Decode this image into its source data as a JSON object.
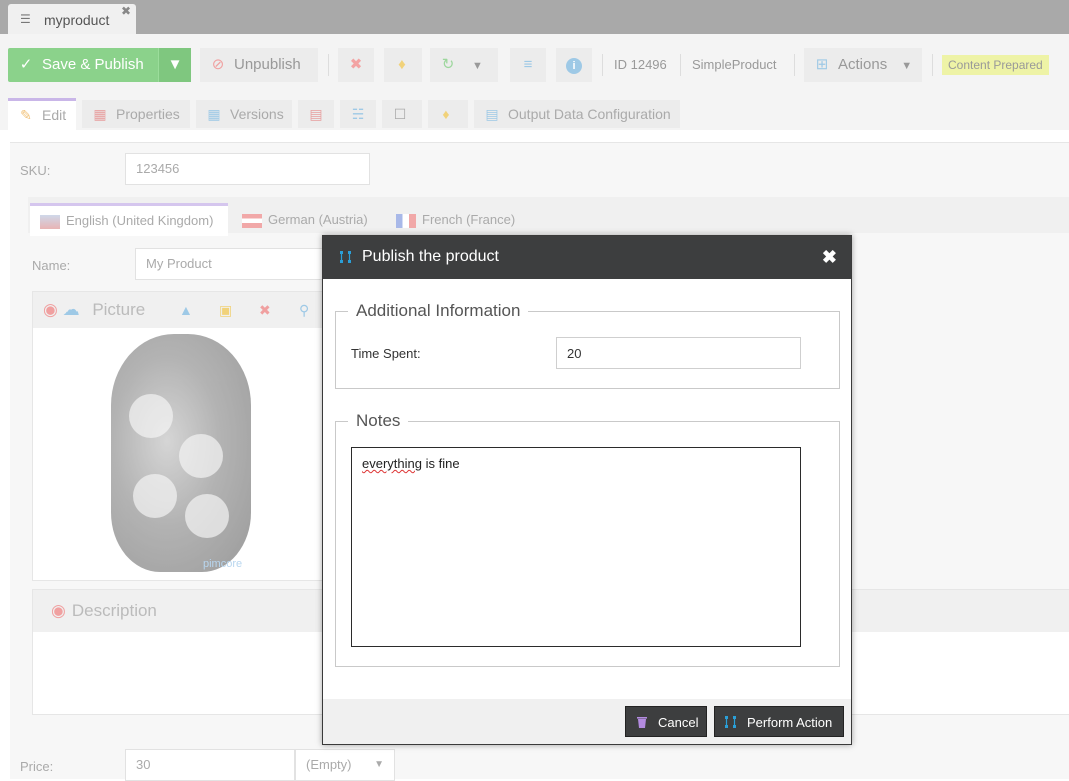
{
  "document_tab": {
    "title": "myproduct"
  },
  "toolbar": {
    "save_publish": "Save & Publish",
    "unpublish": "Unpublish",
    "id_label": "ID 12496",
    "class_label": "SimpleProduct",
    "actions": "Actions",
    "status": "Content Prepared"
  },
  "subtabs": {
    "edit": "Edit",
    "properties": "Properties",
    "versions": "Versions",
    "output": "Output Data Configuration"
  },
  "form": {
    "sku_label": "SKU:",
    "sku_value": "123456",
    "languages": [
      "English (United Kingdom)",
      "German (Austria)",
      "French (France)"
    ],
    "name_label": "Name:",
    "name_value": "My Product",
    "picture_label": "Picture",
    "description_label": "Description",
    "watermark": "pimcore",
    "price_label": "Price:",
    "price_value": "30",
    "price_unit": "(Empty)"
  },
  "modal": {
    "title": "Publish the product",
    "additional_legend": "Additional Information",
    "time_label": "Time Spent:",
    "time_value": "20",
    "notes_legend": "Notes",
    "notes_value_word1": "everything",
    "notes_value_rest": " is fine",
    "cancel": "Cancel",
    "perform": "Perform Action"
  },
  "colors": {
    "header_bg": "#3d3e3f",
    "save_green": "#8bd28b",
    "status_badge": "#eef3a6",
    "icon_blue": "#2a9fd8"
  }
}
